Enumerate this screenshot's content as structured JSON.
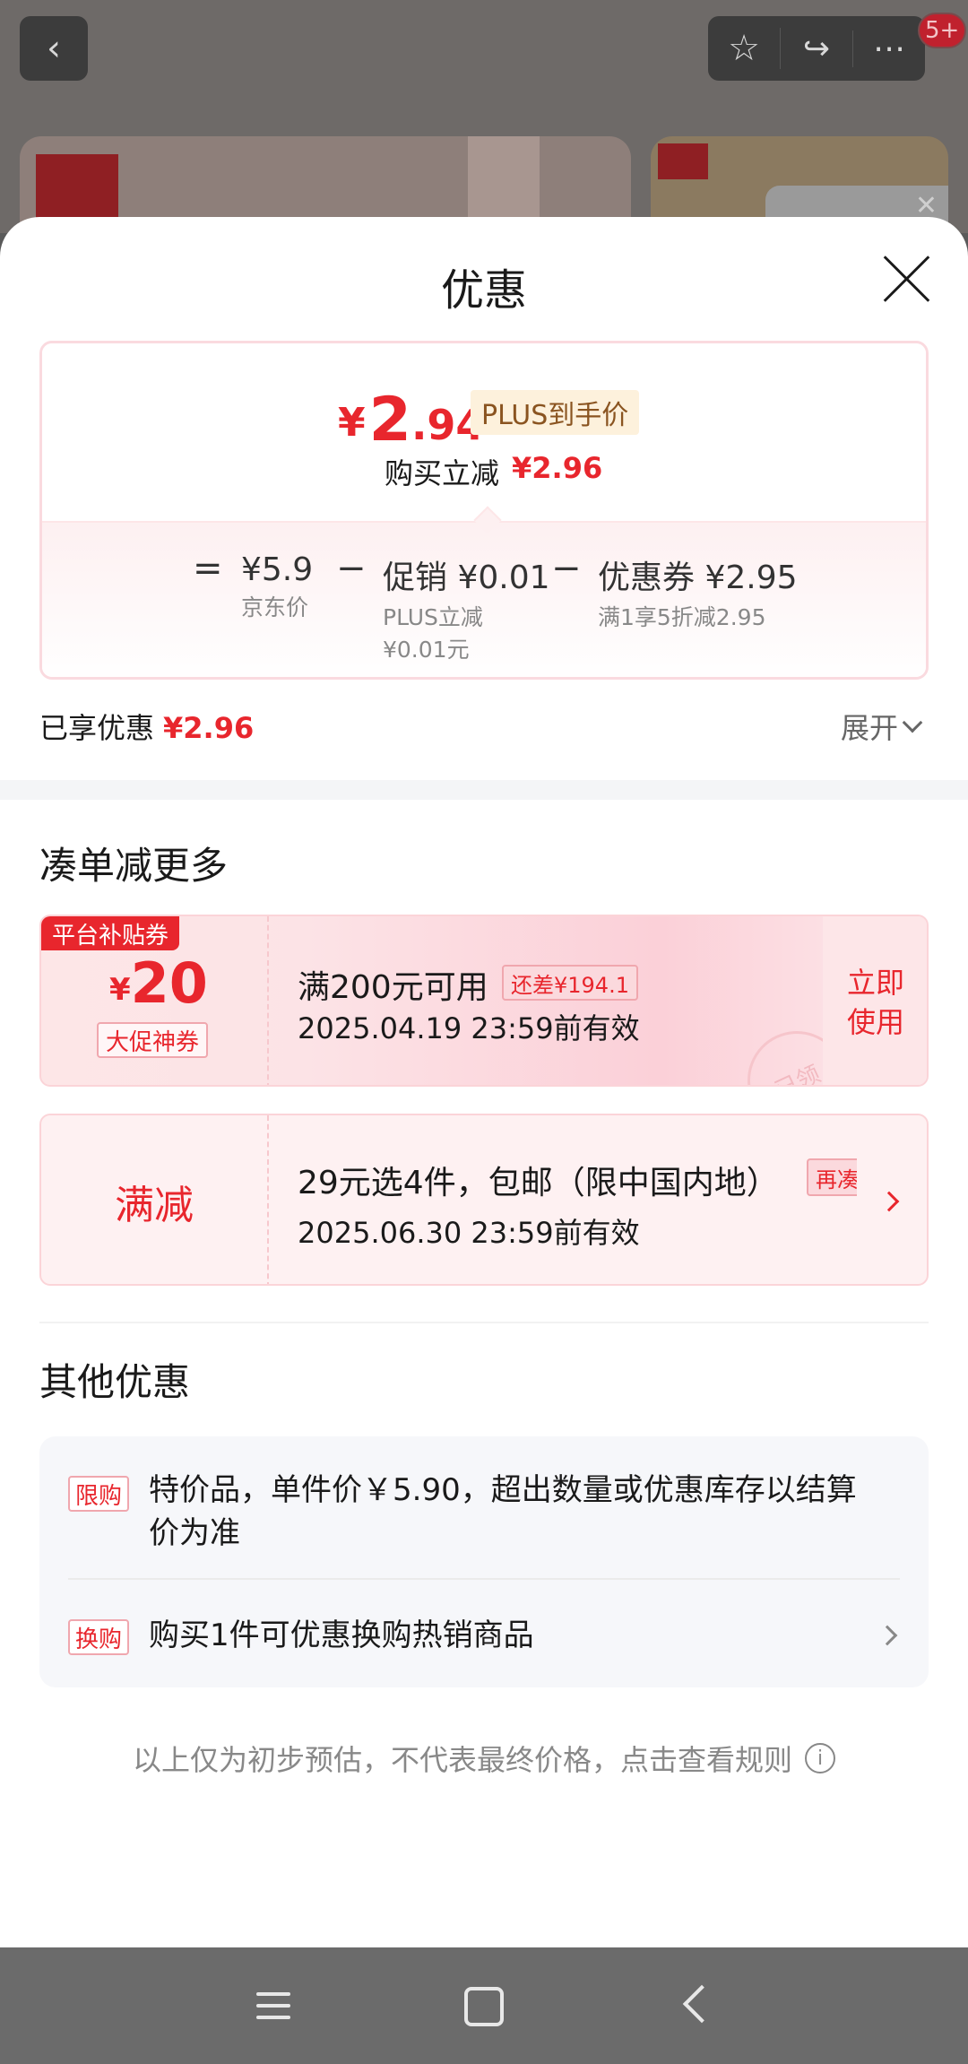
{
  "background": {
    "badge_count": "5+"
  },
  "sheet": {
    "title": "优惠"
  },
  "price_card": {
    "yen": "¥",
    "price_int": "2",
    "price_dec": ".94",
    "plus_tag": "PLUS到手价",
    "buy_reduce_label": "购买立减",
    "buy_reduce_amount": "¥2.96",
    "equals": "=",
    "minus": "−",
    "jd_price": "¥5.9",
    "jd_price_label": "京东价",
    "promo_label": "促销 ¥0.01",
    "promo_sub_line1": "PLUS立减",
    "promo_sub_line2": "¥0.01元",
    "coupon_label": "优惠券 ¥2.95",
    "coupon_sub": "满1享5折减2.95"
  },
  "enjoyed": {
    "label": "已享优惠",
    "amount": "¥2.96",
    "expand_label": "展开"
  },
  "more_section": {
    "title": "凑单减更多",
    "coupon1": {
      "tag": "平台补贴券",
      "yen": "¥",
      "amount": "20",
      "label": "大促神券",
      "condition": "满200元可用",
      "extra_tag": "还差¥194.1",
      "validity": "2025.04.19 23:59前有效",
      "action_line1": "立即",
      "action_line2": "使用",
      "stamp": "已领"
    },
    "coupon2": {
      "label": "满减",
      "condition": "29元选4件，包邮（限中国内地）",
      "extra_tag": "再凑",
      "validity": "2025.06.30 23:59前有效"
    }
  },
  "other_section": {
    "title": "其他优惠",
    "items": [
      {
        "tag": "限购",
        "text_line1": "特价品，单件价￥5.90，超出数量或优惠库存以结算",
        "text_line2": "价为准"
      },
      {
        "tag": "换购",
        "text_line1": "购买1件可优惠换购热销商品"
      }
    ]
  },
  "footnote": {
    "text": "以上仅为初步预估，不代表最终价格，点击查看规则",
    "icon": "i"
  }
}
